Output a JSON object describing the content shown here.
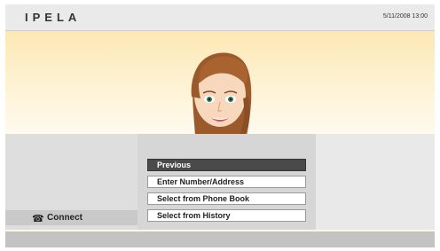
{
  "header": {
    "brand": "IPELA",
    "datetime": "5/11/2008 13:00"
  },
  "menu": {
    "items": [
      {
        "label": "Previous",
        "selected": true
      },
      {
        "label": "Enter Number/Address",
        "selected": false
      },
      {
        "label": "Select from Phone Book",
        "selected": false
      },
      {
        "label": "Select from History",
        "selected": false
      }
    ]
  },
  "connect": {
    "label": "Connect",
    "icon": "telephone-icon"
  },
  "colors": {
    "selected": "#4a4a4a",
    "hero": "#fde8b4"
  }
}
